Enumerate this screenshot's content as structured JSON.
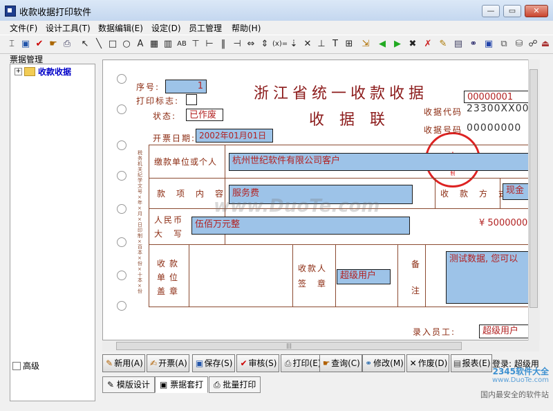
{
  "window": {
    "title": "收款收据打印软件"
  },
  "menu": [
    "文件(F)",
    "设计工具(T)",
    "数据编辑(E)",
    "设定(D)",
    "员工管理",
    "帮助(H)"
  ],
  "left": {
    "header": "票据管理",
    "tree_item": "收款收据",
    "advanced_label": "高级"
  },
  "receipt": {
    "seq_label": "序号:",
    "seq_value": "1",
    "print_flag_label": "打印标志:",
    "status_label": "状态:",
    "status_value": "已作废",
    "title": "浙江省统一收款收据",
    "subtitle": "收　据　联",
    "code_box": "00000001",
    "receipt_code_label": "收据代码",
    "receipt_code_value": "23300XX00",
    "receipt_no_label": "收据号码",
    "receipt_no_value": "00000000",
    "date_label": "开票日期:",
    "date_value": "2002年01月01日",
    "payer_label": "缴款单位或个人",
    "payer_value": "杭州世纪软件有限公司客户",
    "item_label": "款　项　内　容",
    "item_value": "服务费",
    "pay_method_label": "收　款　方　式",
    "pay_method_value": "现金",
    "rmb_label_1": "人民币",
    "rmb_label_2": "大　写",
    "rmb_value": "伍佰万元整",
    "amount_value": "¥ 5000000",
    "unit_seal_label": "收款单位盖章",
    "payee_label_1": "收款人",
    "payee_label_2": "签　章",
    "payee_value": "超级用户",
    "note_label_1": "备",
    "note_label_2": "注",
    "note_value": "测试数据, 您可以",
    "entry_label": "录入员工:",
    "entry_value": "超级用户",
    "side_text": "税务机关纪学文号×年×月×日印制×百本×份×十本×份",
    "seal_text": "浙江省地方税务局监制",
    "watermark": "www.DuoTe.com"
  },
  "buttons": [
    "新用(A)",
    "开票(A)",
    "保存(S)",
    "审核(S)",
    "打印(E)",
    "查询(C)",
    "修改(M)",
    "作废(D)",
    "报表(E)"
  ],
  "login": "登录: 超级用",
  "tabs": [
    "模版设计",
    "票据套打",
    "批量打印"
  ],
  "corner_logo": {
    "brand": "2345软件大全",
    "url": "www.DuoTe.com",
    "tagline": "国内最安全的软件站"
  }
}
